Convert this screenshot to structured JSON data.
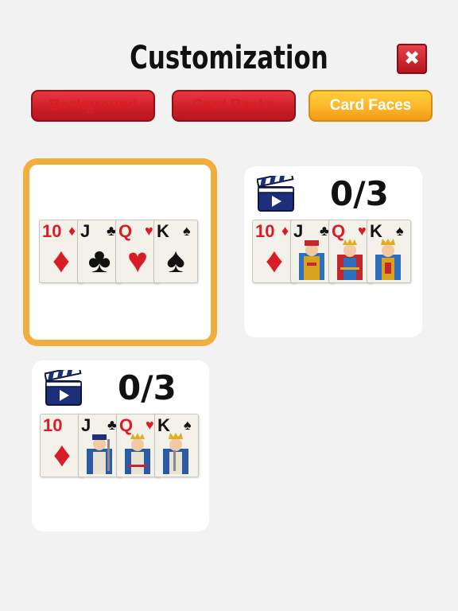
{
  "title": "Customization",
  "tabs": [
    {
      "label": "Background"
    },
    {
      "label": "Card Backs"
    },
    {
      "label": "Card Faces"
    }
  ],
  "panels": [
    {
      "counter": null
    },
    {
      "counter": "0/3"
    },
    {
      "counter": "0/3"
    }
  ],
  "cards": [
    {
      "rank": "10",
      "suit": "♦",
      "color": "red"
    },
    {
      "rank": "J",
      "suit": "♣",
      "color": "black"
    },
    {
      "rank": "Q",
      "suit": "♥",
      "color": "red"
    },
    {
      "rank": "K",
      "suit": "♠",
      "color": "black"
    }
  ],
  "colors": {
    "selected_border": "#f2ae3c",
    "tab_active": "#fbb62a",
    "tab_inactive": "#cf1f28"
  }
}
